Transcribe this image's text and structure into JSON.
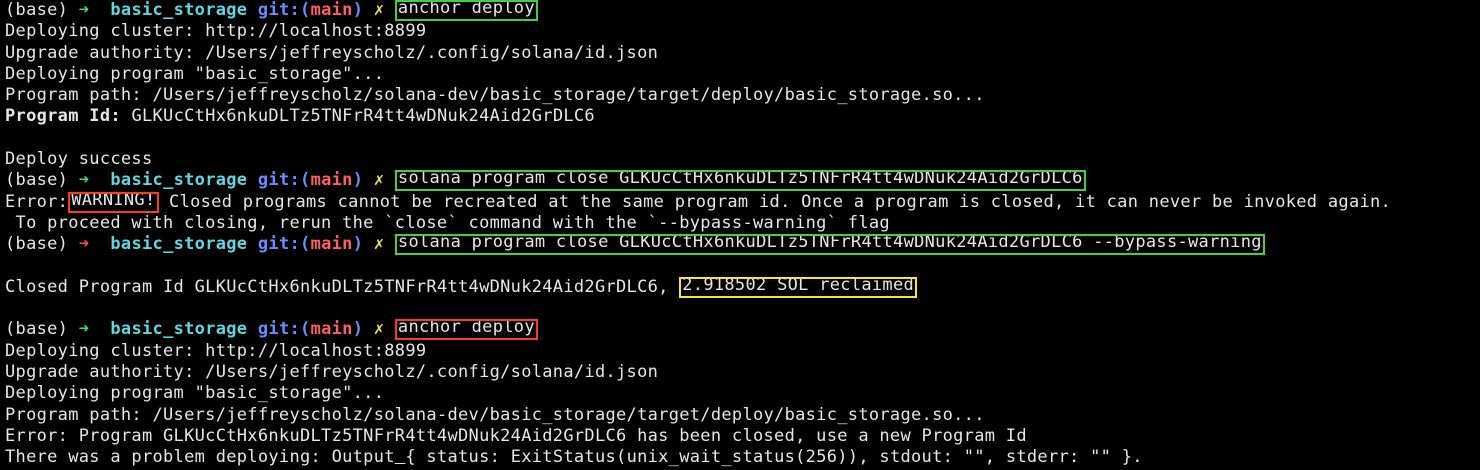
{
  "theme": {
    "background": "#000000",
    "foreground": "#e6e6e6",
    "prompt_arrow_success": "#4fd36b",
    "prompt_arrow_error": "#ff4d4d",
    "directory_color": "#5fd7e0",
    "git_color": "#6b8cff",
    "branch_color": "#ff5f5f",
    "dirty_mark_color": "#f2e35a",
    "highlight_green": "#3fd13f",
    "highlight_red": "#ff3b1f",
    "highlight_yellow": "#ffe51a"
  },
  "prompt": {
    "env": "(base)",
    "arrow": "➜",
    "directory": "basic_storage",
    "git_label": "git:(",
    "branch": "main",
    "git_close": ")",
    "dirty_mark": "✗"
  },
  "block1": {
    "command": "anchor deploy",
    "output": [
      "Deploying cluster: http://localhost:8899",
      "Upgrade authority: /Users/jeffreyscholz/.config/solana/id.json",
      "Deploying program \"basic_storage\"...",
      "Program path: /Users/jeffreyscholz/solana-dev/basic_storage/target/deploy/basic_storage.so..."
    ],
    "program_id_label": "Program Id:",
    "program_id_value": "GLKUcCtHx6nkuDLTz5TNFrR4tt4wDNuk24Aid2GrDLC6",
    "success": "Deploy success"
  },
  "block2": {
    "command": "solana program close GLKUcCtHx6nkuDLTz5TNFrR4tt4wDNuk24Aid2GrDLC6",
    "error_prefix": "Error:",
    "warning": "WARNING!",
    "error_rest": "Closed programs cannot be recreated at the same program id. Once a program is closed, it can never be invoked again.",
    "error_line2": " To proceed with closing, rerun the `close` command with the `--bypass-warning` flag"
  },
  "block3": {
    "command": "solana program close GLKUcCtHx6nkuDLTz5TNFrR4tt4wDNuk24Aid2GrDLC6 --bypass-warning",
    "closed_prefix": "Closed Program Id GLKUcCtHx6nkuDLTz5TNFrR4tt4wDNuk24Aid2GrDLC6,",
    "reclaimed": "2.918502 SOL reclaimed"
  },
  "block4": {
    "command": "anchor deploy",
    "output": [
      "Deploying cluster: http://localhost:8899",
      "Upgrade authority: /Users/jeffreyscholz/.config/solana/id.json",
      "Deploying program \"basic_storage\"...",
      "Program path: /Users/jeffreyscholz/solana-dev/basic_storage/target/deploy/basic_storage.so...",
      "Error: Program GLKUcCtHx6nkuDLTz5TNFrR4tt4wDNuk24Aid2GrDLC6 has been closed, use a new Program Id"
    ],
    "problem_prefix": "There was a problem deploying: Output",
    "problem_cursor": " ",
    "problem_rest": "{ status: ExitStatus(unix_wait_status(256)), stdout: \"\", stderr: \"\" }."
  }
}
